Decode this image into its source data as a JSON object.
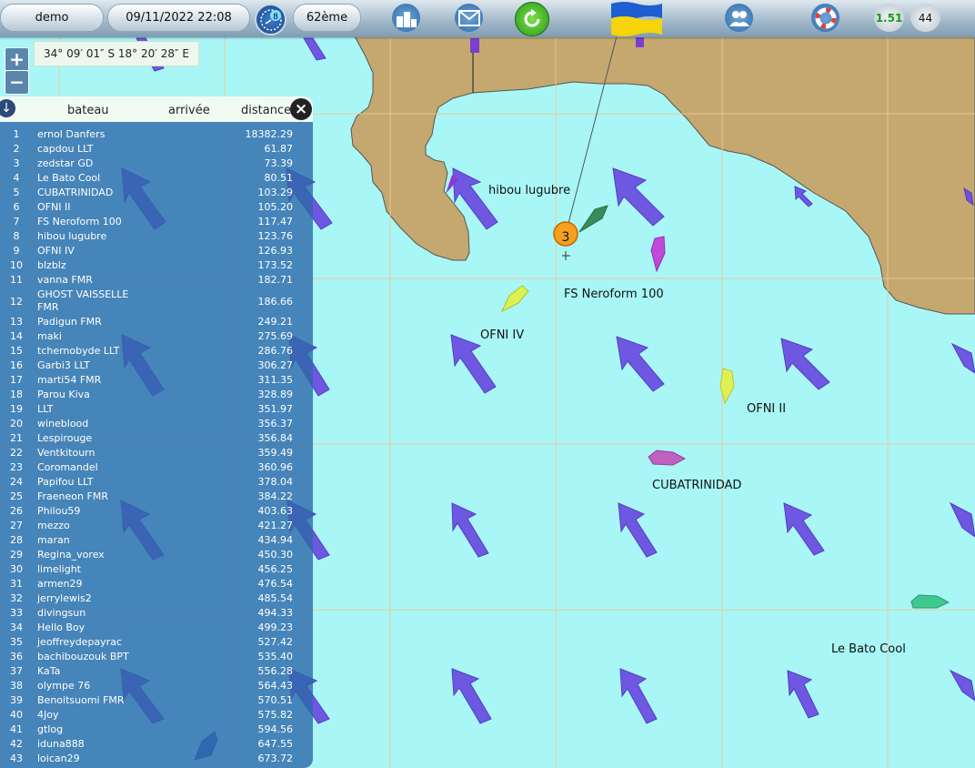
{
  "toolbar": {
    "user": "demo",
    "datetime": "09/11/2022 22:08",
    "wind_badge": "8",
    "rank": "62ème",
    "stat1": "1.51",
    "stat2": "44",
    "marker_number": "3",
    "icons": [
      "clock-icon",
      "podium-icon",
      "mail-icon",
      "refresh-icon",
      "ukraine-flag",
      "players-icon",
      "lifebuoy-icon"
    ]
  },
  "map": {
    "coordinates": "34° 09′ 01″ S 18° 20′ 28″ E",
    "zoom_in": "+",
    "zoom_out": "−",
    "boat_labels": [
      "hibou lugubre",
      "FS Neroform 100",
      "OFNI IV",
      "OFNI II",
      "CUBATRINIDAD",
      "Le Bato Cool"
    ],
    "colors": {
      "sea": "#a9f6f6",
      "land": "#c4a86f",
      "arrow": "#6a4be0",
      "grid": "#f0c890"
    }
  },
  "ranking": {
    "col_boat": "bateau",
    "col_arrival": "arrivée",
    "col_distance": "distance",
    "rows": [
      {
        "rank": "1",
        "name": "ernol Danfers",
        "distance": "18382.29"
      },
      {
        "rank": "2",
        "name": "capdou LLT",
        "distance": "61.87"
      },
      {
        "rank": "3",
        "name": "zedstar GD",
        "distance": "73.39"
      },
      {
        "rank": "4",
        "name": "Le Bato Cool",
        "distance": "80.51"
      },
      {
        "rank": "5",
        "name": "CUBATRINIDAD",
        "distance": "103.29"
      },
      {
        "rank": "6",
        "name": "OFNI II",
        "distance": "105.20"
      },
      {
        "rank": "7",
        "name": "FS Neroform 100",
        "distance": "117.47"
      },
      {
        "rank": "8",
        "name": "hibou lugubre",
        "distance": "123.76"
      },
      {
        "rank": "9",
        "name": "OFNI IV",
        "distance": "126.93"
      },
      {
        "rank": "10",
        "name": "blzblz",
        "distance": "173.52"
      },
      {
        "rank": "11",
        "name": "vanna FMR",
        "distance": "182.71"
      },
      {
        "rank": "12",
        "name": "GHOST VAISSELLE FMR",
        "distance": "186.66"
      },
      {
        "rank": "13",
        "name": "Padigun FMR",
        "distance": "249.21"
      },
      {
        "rank": "14",
        "name": "maki",
        "distance": "275.69"
      },
      {
        "rank": "15",
        "name": "tchernobyde LLT",
        "distance": "286.76"
      },
      {
        "rank": "16",
        "name": "Garbi3 LLT",
        "distance": "306.27"
      },
      {
        "rank": "17",
        "name": "marti54 FMR",
        "distance": "311.35"
      },
      {
        "rank": "18",
        "name": "Parou Kiva",
        "distance": "328.89"
      },
      {
        "rank": "19",
        "name": "LLT",
        "distance": "351.97"
      },
      {
        "rank": "20",
        "name": "wineblood",
        "distance": "356.37"
      },
      {
        "rank": "21",
        "name": "Lespirouge",
        "distance": "356.84"
      },
      {
        "rank": "22",
        "name": "Ventkitourn",
        "distance": "359.49"
      },
      {
        "rank": "23",
        "name": "Coromandel",
        "distance": "360.96"
      },
      {
        "rank": "24",
        "name": "Papifou LLT",
        "distance": "378.04"
      },
      {
        "rank": "25",
        "name": "Fraeneon FMR",
        "distance": "384.22"
      },
      {
        "rank": "26",
        "name": "Philou59",
        "distance": "403.63"
      },
      {
        "rank": "27",
        "name": "mezzo",
        "distance": "421.27"
      },
      {
        "rank": "28",
        "name": "maran",
        "distance": "434.94"
      },
      {
        "rank": "29",
        "name": "Regina_vorex",
        "distance": "450.30"
      },
      {
        "rank": "30",
        "name": "limelight",
        "distance": "456.25"
      },
      {
        "rank": "31",
        "name": "armen29",
        "distance": "476.54"
      },
      {
        "rank": "32",
        "name": "jerrylewis2",
        "distance": "485.54"
      },
      {
        "rank": "33",
        "name": "divingsun",
        "distance": "494.33"
      },
      {
        "rank": "34",
        "name": "Hello Boy",
        "distance": "499.23"
      },
      {
        "rank": "35",
        "name": "jeoffreydepayrac",
        "distance": "527.42"
      },
      {
        "rank": "36",
        "name": "bachibouzouk BPT",
        "distance": "535.40"
      },
      {
        "rank": "37",
        "name": "KaTa",
        "distance": "556.28"
      },
      {
        "rank": "38",
        "name": "olympe 76",
        "distance": "564.43"
      },
      {
        "rank": "39",
        "name": "Benoitsuomi FMR",
        "distance": "570.51"
      },
      {
        "rank": "40",
        "name": "4Joy",
        "distance": "575.82"
      },
      {
        "rank": "41",
        "name": "gtlog",
        "distance": "594.56"
      },
      {
        "rank": "42",
        "name": "iduna888",
        "distance": "647.55"
      },
      {
        "rank": "43",
        "name": "loican29",
        "distance": "673.72"
      }
    ]
  }
}
